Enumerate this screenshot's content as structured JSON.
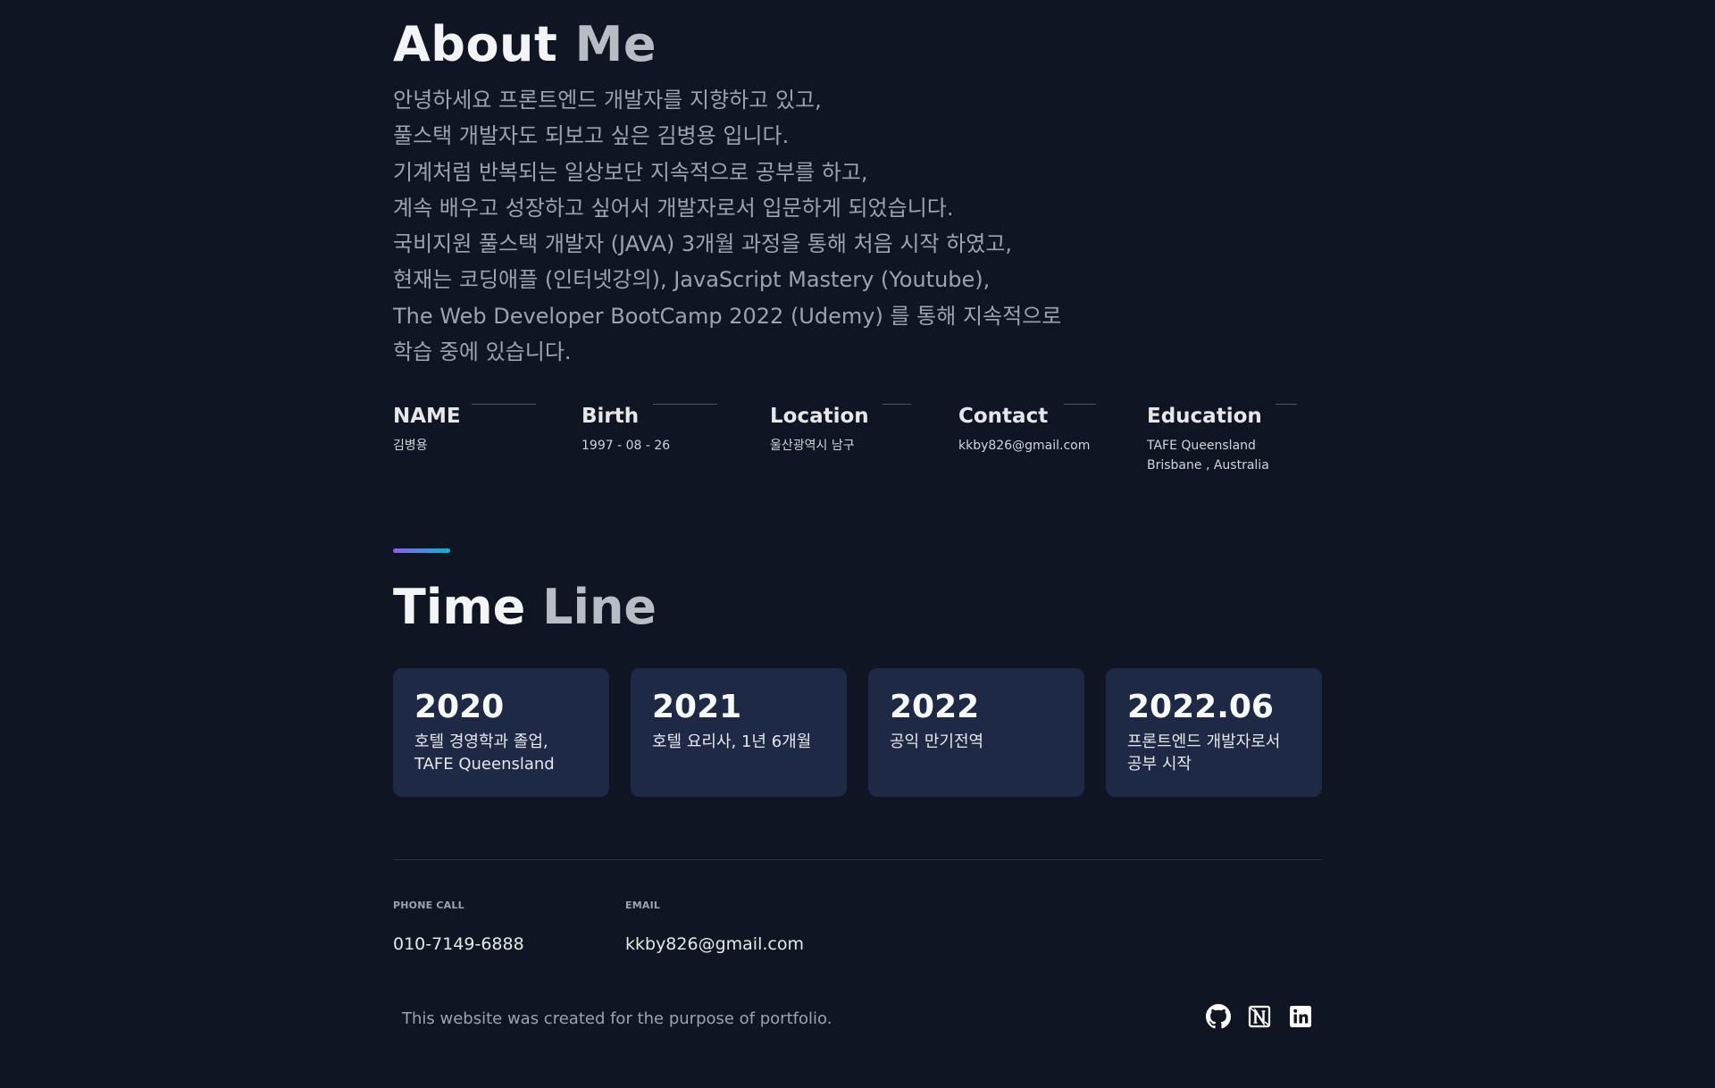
{
  "about": {
    "title_word1": "About",
    "title_word2": "Me",
    "lines": [
      "안녕하세요 프론트엔드 개발자를 지향하고 있고,",
      "풀스택 개발자도 되보고 싶은 김병용 입니다.",
      "기계처럼 반복되는 일상보단 지속적으로 공부를 하고,",
      "계속 배우고 성장하고 싶어서 개발자로서 입문하게 되었습니다.",
      "국비지원 풀스택 개발자 (JAVA) 3개월 과정을 통해 처음 시작 하였고,",
      "현재는 코딩애플 (인터넷강의), JavaScript Mastery (Youtube),",
      "The Web Developer BootCamp 2022 (Udemy) 를 통해 지속적으로",
      "학습 중에 있습니다."
    ]
  },
  "info": [
    {
      "label": "NAME",
      "value": "김병용"
    },
    {
      "label": "Birth",
      "value": "1997 - 08 - 26"
    },
    {
      "label": "Location",
      "value": "울산광역시 남구"
    },
    {
      "label": "Contact",
      "value": "kkby826@gmail.com"
    },
    {
      "label": "Education",
      "value": "TAFE Queensland",
      "value2": "Brisbane , Australia"
    }
  ],
  "timeline": {
    "title_word1": "Time",
    "title_word2": "Line",
    "cards": [
      {
        "year": "2020",
        "desc": "호텔 경영학과 졸업,",
        "desc2": "TAFE Queensland"
      },
      {
        "year": "2021",
        "desc": "호텔 요리사, 1년 6개월",
        "desc2": ""
      },
      {
        "year": "2022",
        "desc": "공익 만기전역",
        "desc2": ""
      },
      {
        "year": "2022.06",
        "desc": "프론트엔드 개발자로서",
        "desc2": "공부 시작"
      }
    ]
  },
  "contact": {
    "phone_label": "PHONE CALL",
    "phone_value": "010-7149-6888",
    "email_label": "EMAIL",
    "email_value": "kkby826@gmail.com"
  },
  "footer": {
    "text": "This website was created for the purpose of portfolio.",
    "icons": [
      "github-icon",
      "notion-icon",
      "linkedin-icon"
    ]
  },
  "colors": {
    "background": "#0f1522",
    "card": "#1e2a45",
    "accent_start": "#8b5cf6",
    "accent_end": "#06b6d4"
  }
}
